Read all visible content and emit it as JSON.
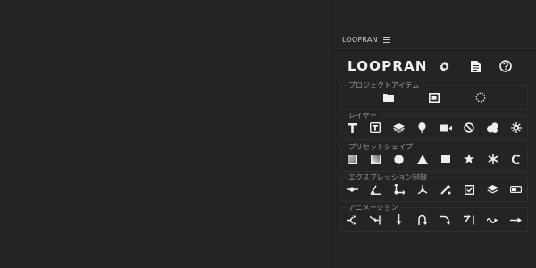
{
  "panel": {
    "title": "LOOPRAN",
    "menu_icon": "hamburger-icon"
  },
  "brand": {
    "logo_text": "LOOPRAN",
    "buttons": [
      {
        "name": "settings",
        "icon": "gear-icon"
      },
      {
        "name": "document",
        "icon": "document-icon"
      },
      {
        "name": "help",
        "icon": "help-icon"
      }
    ]
  },
  "sections": {
    "project_items": {
      "title": "プロジェクトアイテム",
      "items": [
        {
          "name": "folder",
          "icon": "folder-icon"
        },
        {
          "name": "composition",
          "icon": "composition-icon"
        },
        {
          "name": "refresh",
          "icon": "dotted-circle-icon"
        }
      ]
    },
    "layers": {
      "title": "レイヤー",
      "items": [
        {
          "name": "text-layer",
          "icon": "text-icon"
        },
        {
          "name": "text-box-layer",
          "icon": "text-box-icon"
        },
        {
          "name": "solid-layer",
          "icon": "layers-icon"
        },
        {
          "name": "light-layer",
          "icon": "light-bulb-icon"
        },
        {
          "name": "camera-layer",
          "icon": "camera-icon"
        },
        {
          "name": "null-layer",
          "icon": "null-icon"
        },
        {
          "name": "shape-layer",
          "icon": "shapes-icon"
        },
        {
          "name": "adjustment-layer",
          "icon": "adjustment-icon"
        }
      ]
    },
    "preset_shapes": {
      "title": "プリセットシェイプ",
      "items": [
        {
          "name": "rectangle-gradient",
          "icon": "rect-gradient-icon"
        },
        {
          "name": "rectangle-gradient-2",
          "icon": "rect-gradient-2-icon"
        },
        {
          "name": "circle",
          "icon": "circle-icon"
        },
        {
          "name": "triangle",
          "icon": "triangle-icon"
        },
        {
          "name": "square",
          "icon": "square-icon"
        },
        {
          "name": "star",
          "icon": "star-icon"
        },
        {
          "name": "asterisk",
          "icon": "asterisk-icon"
        },
        {
          "name": "arc",
          "icon": "arc-icon"
        }
      ]
    },
    "expression_controls": {
      "title": "エクスプレッション制御",
      "items": [
        {
          "name": "slider-control",
          "icon": "slider-icon"
        },
        {
          "name": "angle-control",
          "icon": "angle-icon"
        },
        {
          "name": "point-control",
          "icon": "point-icon"
        },
        {
          "name": "3d-point-control",
          "icon": "3d-point-icon"
        },
        {
          "name": "color-control",
          "icon": "color-picker-icon"
        },
        {
          "name": "checkbox-control",
          "icon": "checkbox-icon"
        },
        {
          "name": "layer-control",
          "icon": "layer-stack-icon"
        },
        {
          "name": "dropdown-control",
          "icon": "toggle-icon"
        }
      ]
    },
    "animation": {
      "title": "アニメーション",
      "items": [
        {
          "name": "anim-split",
          "icon": "split-arrow-icon"
        },
        {
          "name": "anim-bounce-in",
          "icon": "bounce-in-icon"
        },
        {
          "name": "anim-down",
          "icon": "arrow-down-icon"
        },
        {
          "name": "anim-loop",
          "icon": "u-turn-icon"
        },
        {
          "name": "anim-curve",
          "icon": "curve-arrow-icon"
        },
        {
          "name": "anim-corner",
          "icon": "corner-arrow-icon"
        },
        {
          "name": "anim-wave",
          "icon": "wave-arrow-icon"
        },
        {
          "name": "anim-right",
          "icon": "arrow-right-icon"
        }
      ]
    }
  },
  "colors": {
    "icon": "#efefef",
    "frame": "#303030",
    "section_title": "#9a9a9a",
    "panel_bg": "#242424",
    "left_bg": "#252525"
  }
}
